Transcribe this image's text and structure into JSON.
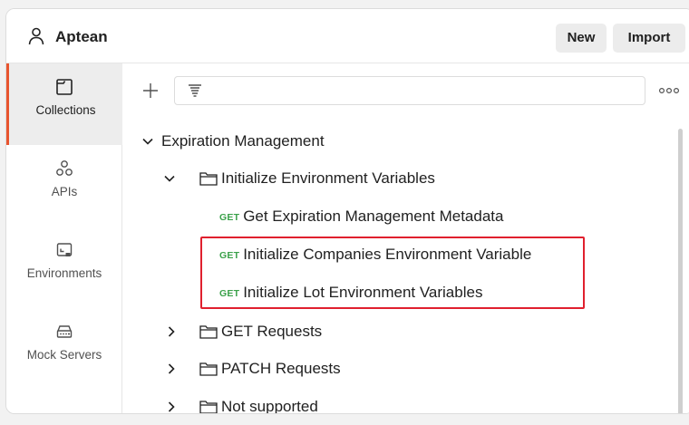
{
  "header": {
    "workspace_name": "Aptean",
    "new_label": "New",
    "import_label": "Import"
  },
  "sidebar": {
    "items": [
      {
        "label": "Collections",
        "icon": "collections-icon",
        "active": true
      },
      {
        "label": "APIs",
        "icon": "apis-icon",
        "active": false
      },
      {
        "label": "Environments",
        "icon": "environments-icon",
        "active": false
      },
      {
        "label": "Mock Servers",
        "icon": "mock-servers-icon",
        "active": false
      }
    ]
  },
  "tree": {
    "collection": "Expiration Management",
    "folder_open": "Initialize Environment Variables",
    "requests": [
      {
        "method": "GET",
        "name": "Get Expiration Management Metadata"
      },
      {
        "method": "GET",
        "name": "Initialize Companies Environment Variable"
      },
      {
        "method": "GET",
        "name": "Initialize Lot Environment Variables"
      }
    ],
    "folders_closed": [
      "GET Requests",
      "PATCH Requests",
      "Not supported"
    ]
  },
  "colors": {
    "accent": "#e8552f",
    "get_method": "#3aa14a",
    "highlight": "#e0202e"
  }
}
